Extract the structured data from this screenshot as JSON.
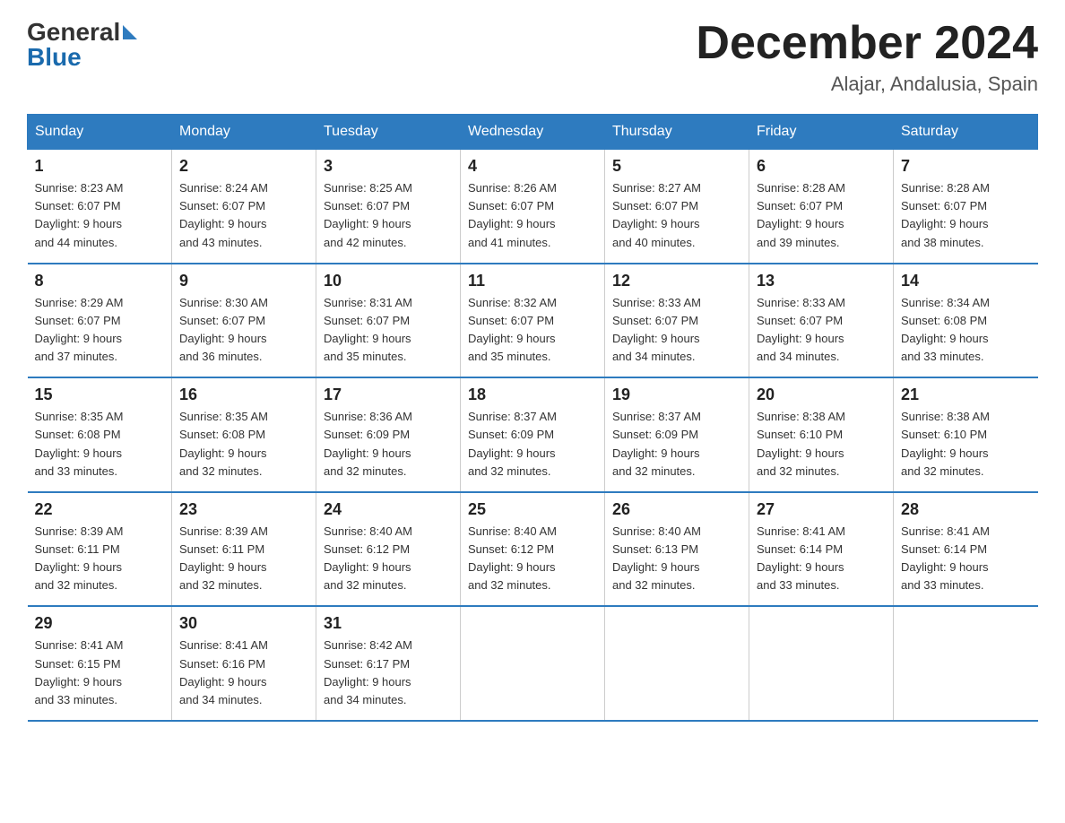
{
  "header": {
    "logo": {
      "general": "General",
      "blue": "Blue"
    },
    "title": "December 2024",
    "location": "Alajar, Andalusia, Spain"
  },
  "weekdays": [
    "Sunday",
    "Monday",
    "Tuesday",
    "Wednesday",
    "Thursday",
    "Friday",
    "Saturday"
  ],
  "weeks": [
    [
      {
        "day": "1",
        "sunrise": "8:23 AM",
        "sunset": "6:07 PM",
        "daylight": "9 hours and 44 minutes."
      },
      {
        "day": "2",
        "sunrise": "8:24 AM",
        "sunset": "6:07 PM",
        "daylight": "9 hours and 43 minutes."
      },
      {
        "day": "3",
        "sunrise": "8:25 AM",
        "sunset": "6:07 PM",
        "daylight": "9 hours and 42 minutes."
      },
      {
        "day": "4",
        "sunrise": "8:26 AM",
        "sunset": "6:07 PM",
        "daylight": "9 hours and 41 minutes."
      },
      {
        "day": "5",
        "sunrise": "8:27 AM",
        "sunset": "6:07 PM",
        "daylight": "9 hours and 40 minutes."
      },
      {
        "day": "6",
        "sunrise": "8:28 AM",
        "sunset": "6:07 PM",
        "daylight": "9 hours and 39 minutes."
      },
      {
        "day": "7",
        "sunrise": "8:28 AM",
        "sunset": "6:07 PM",
        "daylight": "9 hours and 38 minutes."
      }
    ],
    [
      {
        "day": "8",
        "sunrise": "8:29 AM",
        "sunset": "6:07 PM",
        "daylight": "9 hours and 37 minutes."
      },
      {
        "day": "9",
        "sunrise": "8:30 AM",
        "sunset": "6:07 PM",
        "daylight": "9 hours and 36 minutes."
      },
      {
        "day": "10",
        "sunrise": "8:31 AM",
        "sunset": "6:07 PM",
        "daylight": "9 hours and 35 minutes."
      },
      {
        "day": "11",
        "sunrise": "8:32 AM",
        "sunset": "6:07 PM",
        "daylight": "9 hours and 35 minutes."
      },
      {
        "day": "12",
        "sunrise": "8:33 AM",
        "sunset": "6:07 PM",
        "daylight": "9 hours and 34 minutes."
      },
      {
        "day": "13",
        "sunrise": "8:33 AM",
        "sunset": "6:07 PM",
        "daylight": "9 hours and 34 minutes."
      },
      {
        "day": "14",
        "sunrise": "8:34 AM",
        "sunset": "6:08 PM",
        "daylight": "9 hours and 33 minutes."
      }
    ],
    [
      {
        "day": "15",
        "sunrise": "8:35 AM",
        "sunset": "6:08 PM",
        "daylight": "9 hours and 33 minutes."
      },
      {
        "day": "16",
        "sunrise": "8:35 AM",
        "sunset": "6:08 PM",
        "daylight": "9 hours and 32 minutes."
      },
      {
        "day": "17",
        "sunrise": "8:36 AM",
        "sunset": "6:09 PM",
        "daylight": "9 hours and 32 minutes."
      },
      {
        "day": "18",
        "sunrise": "8:37 AM",
        "sunset": "6:09 PM",
        "daylight": "9 hours and 32 minutes."
      },
      {
        "day": "19",
        "sunrise": "8:37 AM",
        "sunset": "6:09 PM",
        "daylight": "9 hours and 32 minutes."
      },
      {
        "day": "20",
        "sunrise": "8:38 AM",
        "sunset": "6:10 PM",
        "daylight": "9 hours and 32 minutes."
      },
      {
        "day": "21",
        "sunrise": "8:38 AM",
        "sunset": "6:10 PM",
        "daylight": "9 hours and 32 minutes."
      }
    ],
    [
      {
        "day": "22",
        "sunrise": "8:39 AM",
        "sunset": "6:11 PM",
        "daylight": "9 hours and 32 minutes."
      },
      {
        "day": "23",
        "sunrise": "8:39 AM",
        "sunset": "6:11 PM",
        "daylight": "9 hours and 32 minutes."
      },
      {
        "day": "24",
        "sunrise": "8:40 AM",
        "sunset": "6:12 PM",
        "daylight": "9 hours and 32 minutes."
      },
      {
        "day": "25",
        "sunrise": "8:40 AM",
        "sunset": "6:12 PM",
        "daylight": "9 hours and 32 minutes."
      },
      {
        "day": "26",
        "sunrise": "8:40 AM",
        "sunset": "6:13 PM",
        "daylight": "9 hours and 32 minutes."
      },
      {
        "day": "27",
        "sunrise": "8:41 AM",
        "sunset": "6:14 PM",
        "daylight": "9 hours and 33 minutes."
      },
      {
        "day": "28",
        "sunrise": "8:41 AM",
        "sunset": "6:14 PM",
        "daylight": "9 hours and 33 minutes."
      }
    ],
    [
      {
        "day": "29",
        "sunrise": "8:41 AM",
        "sunset": "6:15 PM",
        "daylight": "9 hours and 33 minutes."
      },
      {
        "day": "30",
        "sunrise": "8:41 AM",
        "sunset": "6:16 PM",
        "daylight": "9 hours and 34 minutes."
      },
      {
        "day": "31",
        "sunrise": "8:42 AM",
        "sunset": "6:17 PM",
        "daylight": "9 hours and 34 minutes."
      },
      null,
      null,
      null,
      null
    ]
  ],
  "labels": {
    "sunrise": "Sunrise:",
    "sunset": "Sunset:",
    "daylight": "Daylight:"
  }
}
